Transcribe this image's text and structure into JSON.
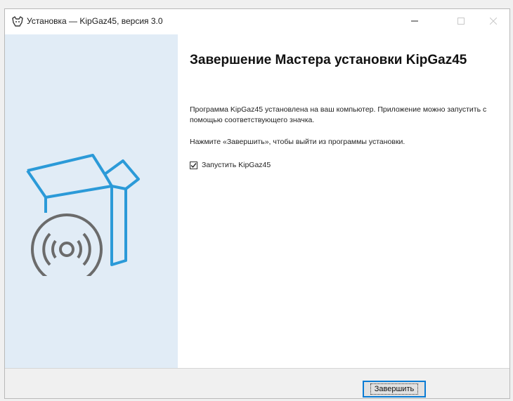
{
  "window": {
    "title": "Установка — KipGaz45, версия 3.0",
    "controls": {
      "minimize_icon": "minimize-icon",
      "maximize_icon": "maximize-icon",
      "close_icon": "close-icon"
    }
  },
  "content": {
    "heading": "Завершение Мастера установки KipGaz45",
    "paragraph1": "Программа KipGaz45 установлена на ваш компьютер. Приложение можно запустить с помощью соответствующего значка.",
    "paragraph2": "Нажмите «Завершить», чтобы выйти из программы установки.",
    "launch_checkbox": {
      "label": "Запустить KipGaz45",
      "checked": true
    }
  },
  "footer": {
    "finish_label": "Завершить"
  },
  "colors": {
    "sidebar_bg": "#e1ecf6",
    "illustration_blue": "#2b9ad8",
    "illustration_gray": "#6b6b6b",
    "button_focus": "#0a7cd4"
  }
}
